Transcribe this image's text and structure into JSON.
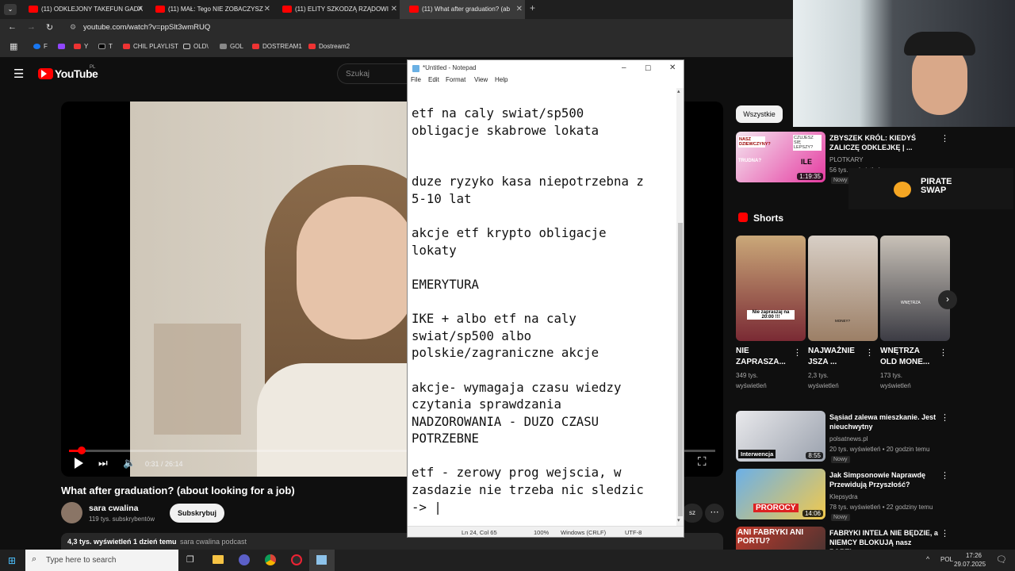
{
  "browser": {
    "tabs": [
      {
        "label": "(11) ODKLEJONY TAKEFUN GADA"
      },
      {
        "label": "(11) MAŁ: Tego NIE ZOBACZYSZ"
      },
      {
        "label": "(11) ELITY SZKODZĄ RZĄDOWI"
      },
      {
        "label": "(11) What after graduation? (ab"
      }
    ],
    "url": "youtube.com/watch?v=ppSlt3wmRUQ",
    "bookmarks": [
      "F",
      "Y",
      "T",
      "CHIL PLAYLIST",
      "OLD\\",
      "GOL",
      "DOSTREAM1",
      "Dostream2"
    ]
  },
  "youtube": {
    "logo": "YouTube",
    "region": "PL",
    "search_placeholder": "Szukaj",
    "video": {
      "time": "0:31 / 26:14",
      "progress": 0.02,
      "title": "What after graduation? (about looking for a job)"
    },
    "channel": {
      "name": "sara cwalina",
      "subs": "119 tys. subskrybentów",
      "subscribe": "Subskrybuj"
    },
    "meta": {
      "views": "4,3 tys. wyświetleń",
      "age": "1 dzień temu",
      "tag": "sara cwalina podcast"
    },
    "chip": "Wszystkie",
    "rec_top": {
      "thumb_text1": "NASZ DZIEWCZYNY?",
      "thumb_text2": "CZUJESZ SIĘ LEPSZY?",
      "thumb_text3": "ILE",
      "thumb_text4": "TRUDNA?",
      "duration": "1:19:35",
      "title": "ZBYSZEK KRÓL: KIEDYŚ ZALICZĘ ODKLEJKĘ | ...",
      "channel": "PLOTKARY",
      "views": "56 tys. wyświetleń",
      "when": "1 dzień temu",
      "badge": "Nowy"
    },
    "overlay_brand": "PIRATE SWAP",
    "shorts_label": "Shorts",
    "shorts": [
      {
        "thumb_caption": "Nie zapraszaj na 20:00 !!!",
        "title": "NIE ZAPRASZA...",
        "views": "349 tys.",
        "views2": "wyświetleń"
      },
      {
        "thumb_caption": "MONEY?",
        "title": "NAJWAŻNIE JSZA ...",
        "views": "2,3 tys.",
        "views2": "wyświetleń"
      },
      {
        "thumb_caption": "WNĘTRZA",
        "title": "WNĘTRZA OLD MONE...",
        "views": "173 tys.",
        "views2": "wyświetleń"
      }
    ],
    "recs": [
      {
        "thumb_caption": "Interwencja",
        "duration": "8:55",
        "title": "Sąsiad zalewa mieszkanie. Jest nieuchwytny",
        "channel": "polsatnews.pl",
        "views": "20 tys. wyświetleń",
        "when": "20 godzin temu",
        "badge": "Nowy"
      },
      {
        "thumb_caption": "PROROCY",
        "duration": "14:06",
        "title": "Jak Simpsonowie Naprawdę Przewidują Przyszłość?",
        "channel": "Klepsydra",
        "views": "78 tys. wyświetleń",
        "when": "22 godziny temu",
        "badge": "Nowy"
      },
      {
        "thumb_caption": "ANI FABRYKI ANI PORTU?",
        "title": "FABRYKI INTELA NIE BĘDZIE, a NIEMCY BLOKUJĄ nasz PORT!..."
      }
    ],
    "more_label": "sz"
  },
  "notepad": {
    "title": "*Untitled - Notepad",
    "menu": [
      "File",
      "Edit",
      "Format",
      "View",
      "Help"
    ],
    "lines": [
      "etf na caly swiat/sp500",
      "obligacje skabrowe lokata",
      "",
      "",
      "duze ryzyko kasa niepotrzebna z",
      "5-10 lat",
      "",
      "akcje etf krypto obligacje",
      "lokaty",
      "",
      "EMERYTURA",
      "",
      "IKE + albo etf na caly",
      "swiat/sp500 albo",
      "polskie/zagraniczne akcje",
      "",
      "akcje- wymagaja czasu wiedzy",
      "czytania sprawdzania",
      "NADZOROWANIA - DUZO CZASU",
      "POTRZEBNE",
      "",
      "etf - zerowy prog wejscia, w",
      "zasdazie nie trzeba nic sledzic",
      "-> |"
    ],
    "status": {
      "pos": "Ln 24, Col 65",
      "zoom": "100%",
      "eol": "Windows (CRLF)",
      "enc": "UTF-8"
    }
  },
  "taskbar": {
    "search": "Type here to search",
    "lang": "POL",
    "time": "17:26",
    "date": "29.07.2025"
  },
  "colors": {
    "yt_red": "#ff0000",
    "accent": "#3ea6ff"
  }
}
